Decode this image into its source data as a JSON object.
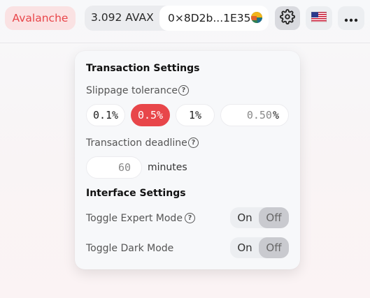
{
  "header": {
    "network_label": "Avalanche",
    "balance": "3.092 AVAX",
    "address": "0×8D2b...1E35"
  },
  "icons": {
    "settings": "gear-icon",
    "language": "us-flag-icon",
    "more": "more-dots-icon",
    "help": "question-circle-icon",
    "avatar": "account-avatar-icon"
  },
  "colors": {
    "accent": "#e8464a",
    "network_bg": "#fae2e3"
  },
  "settings": {
    "transaction_heading": "Transaction Settings",
    "slippage_label": "Slippage tolerance",
    "help_glyph": "?",
    "slippage_options": [
      "0.1%",
      "0.5%",
      "1%"
    ],
    "slippage_selected": "0.5%",
    "custom_slippage_placeholder": "0.50",
    "custom_slippage_unit": "%",
    "deadline_label": "Transaction deadline",
    "deadline_placeholder": "60",
    "deadline_unit": "minutes",
    "interface_heading": "Interface Settings",
    "expert_mode_label": "Toggle Expert Mode",
    "dark_mode_label": "Toggle Dark Mode",
    "toggle_on_label": "On",
    "toggle_off_label": "Off",
    "expert_mode_state": "Off",
    "dark_mode_state": "Off"
  }
}
